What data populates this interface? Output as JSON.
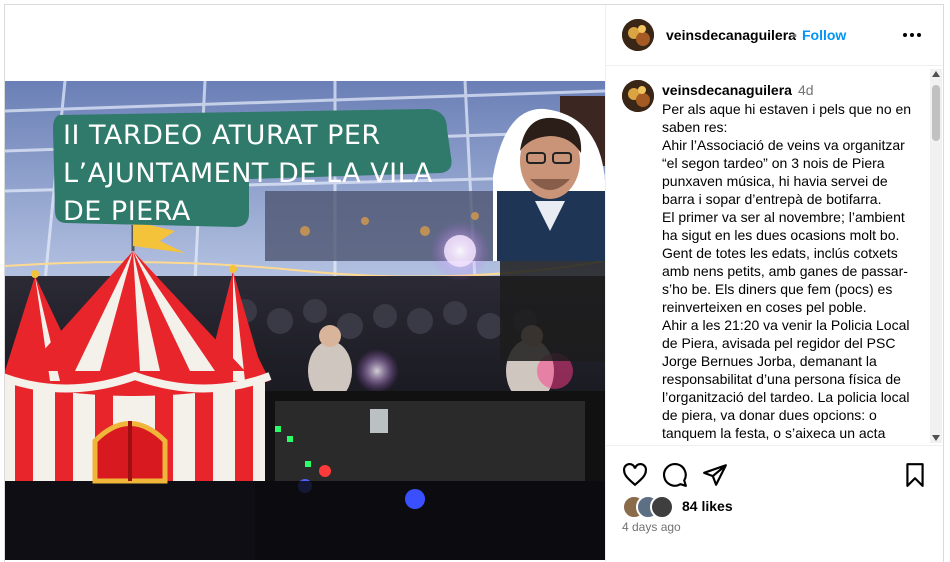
{
  "post": {
    "username": "veinsdecanaguilera",
    "follow_label": "Follow",
    "separator": "•",
    "caption_time": "4d",
    "caption": "Per als aque hi estaven i pels que no en saben res:\nAhir l’Associació de veins va organitzar “el segon tardeo” on 3 nois de Piera punxaven música, hi havia servei de barra i sopar d’entrepà de botifarra.\nEl primer va ser al novembre; l’ambient ha sigut en les dues ocasions molt bo. Gent de totes les edats, inclús cotxets amb nens petits, amb ganes de passar-s’ho be. Els diners que fem (pocs) es reinverteixen en coses pel poble.\nAhir a les 21:20 va venir la Policia Local de Piera, avisada pel regidor del PSC Jorge Bernues Jorba, demanant la responsabilitat d’una persona física de l’organització del tardeo. La policia local de piera, va donar dues opcions: o tanquem la festa, o s’aixeca un acta",
    "likes": "84 likes",
    "posted_ago": "4 days ago"
  },
  "image": {
    "banner_text": "II TARDEO ATURAT PER L’AJUNTAMENT DE LA VILA DE PIERA"
  },
  "icons": {
    "more": "more-horizontal-icon",
    "like": "heart-icon",
    "comment": "comment-icon",
    "share": "share-icon",
    "save": "bookmark-icon"
  },
  "colors": {
    "follow": "#0095f6",
    "muted": "#737373",
    "banner_bg": "#2f7a6a",
    "tent_red": "#e8252b"
  }
}
